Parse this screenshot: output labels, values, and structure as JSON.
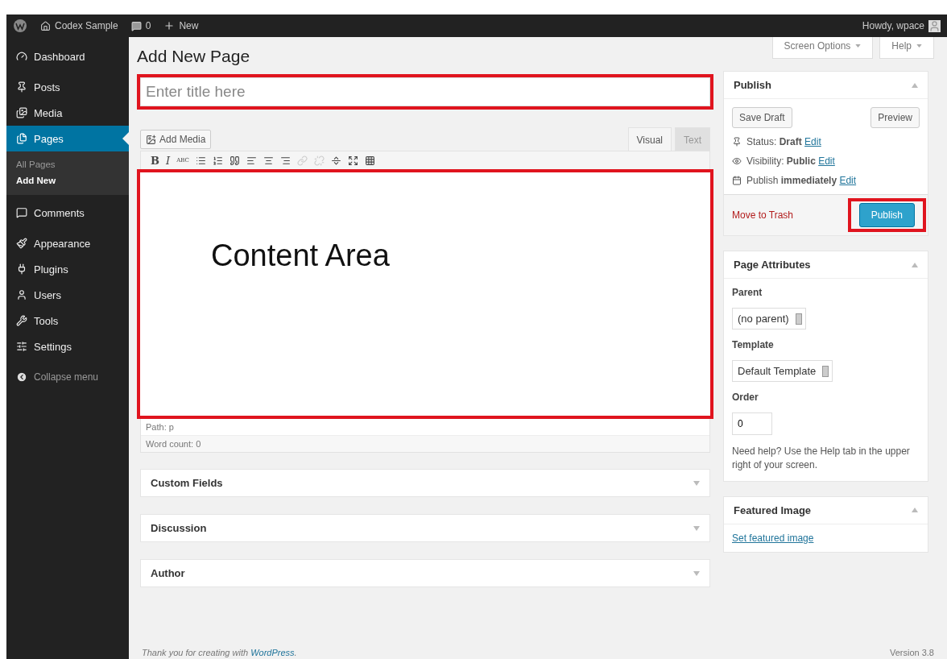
{
  "admin_bar": {
    "site": "Codex Sample",
    "comments": "0",
    "new": "New",
    "greeting": "Howdy, wpace"
  },
  "screen_tabs": [
    "Screen Options",
    "Help"
  ],
  "sidebar": {
    "items": [
      {
        "label": "Dashboard",
        "selected": false
      },
      {
        "label": "Posts",
        "selected": false
      },
      {
        "label": "Media",
        "selected": false
      },
      {
        "label": "Pages",
        "selected": true,
        "children": [
          {
            "label": "All Pages",
            "selected": false
          },
          {
            "label": "Add New",
            "selected": true
          }
        ]
      },
      {
        "label": "Comments",
        "selected": false
      },
      {
        "label": "Appearance",
        "selected": false
      },
      {
        "label": "Plugins",
        "selected": false
      },
      {
        "label": "Users",
        "selected": false
      },
      {
        "label": "Tools",
        "selected": false
      },
      {
        "label": "Settings",
        "selected": false
      }
    ],
    "collapse": "Collapse menu"
  },
  "heading": "Add New Page",
  "title_field": {
    "placeholder": "Enter title here",
    "highlighted": true
  },
  "editor": {
    "add_media": "Add Media",
    "tabs": [
      {
        "label": "Visual",
        "selected": true
      },
      {
        "label": "Text",
        "selected": false
      }
    ],
    "format_letters": [
      "B",
      "I",
      "ABC"
    ],
    "toolbar_icons": [
      {
        "disabled": false
      },
      {
        "disabled": false
      },
      {
        "disabled": false
      },
      {
        "disabled": false
      },
      {
        "disabled": false
      },
      {
        "disabled": false
      },
      {
        "disabled": true
      },
      {
        "disabled": true
      },
      {
        "disabled": false
      },
      {
        "disabled": false
      },
      {
        "disabled": false
      }
    ],
    "content": "Content Area",
    "highlighted": true,
    "path": "Path: p",
    "word_count": "Word count: 0"
  },
  "meta_boxes": [
    {
      "title": "Custom Fields",
      "expanded": false
    },
    {
      "title": "Discussion",
      "expanded": false
    },
    {
      "title": "Author",
      "expanded": false
    }
  ],
  "publish": {
    "title": "Publish",
    "expanded": true,
    "save_draft": "Save Draft",
    "preview": "Preview",
    "rows": [
      {
        "text": "Status: **Draft**",
        "link": "Edit"
      },
      {
        "text": "Visibility: **Public**",
        "link": "Edit"
      },
      {
        "text": "Publish **immediately**",
        "link": "Edit"
      }
    ],
    "trash": "Move to Trash",
    "publish_button": "Publish",
    "highlighted": true
  },
  "page_attributes": {
    "title": "Page Attributes",
    "expanded": true,
    "parent_label": "Parent",
    "parent_value": "(no parent)",
    "template_label": "Template",
    "template_value": "Default Template",
    "order_label": "Order",
    "order_value": "0",
    "help": "Need help? Use the Help tab in the upper right of your screen."
  },
  "featured_image": {
    "title": "Featured Image",
    "expanded": true,
    "link": "Set featured image"
  },
  "footer": {
    "thanks": "Thank you for creating with",
    "link": "WordPress",
    "end": ".",
    "version": "Version 3.8"
  }
}
